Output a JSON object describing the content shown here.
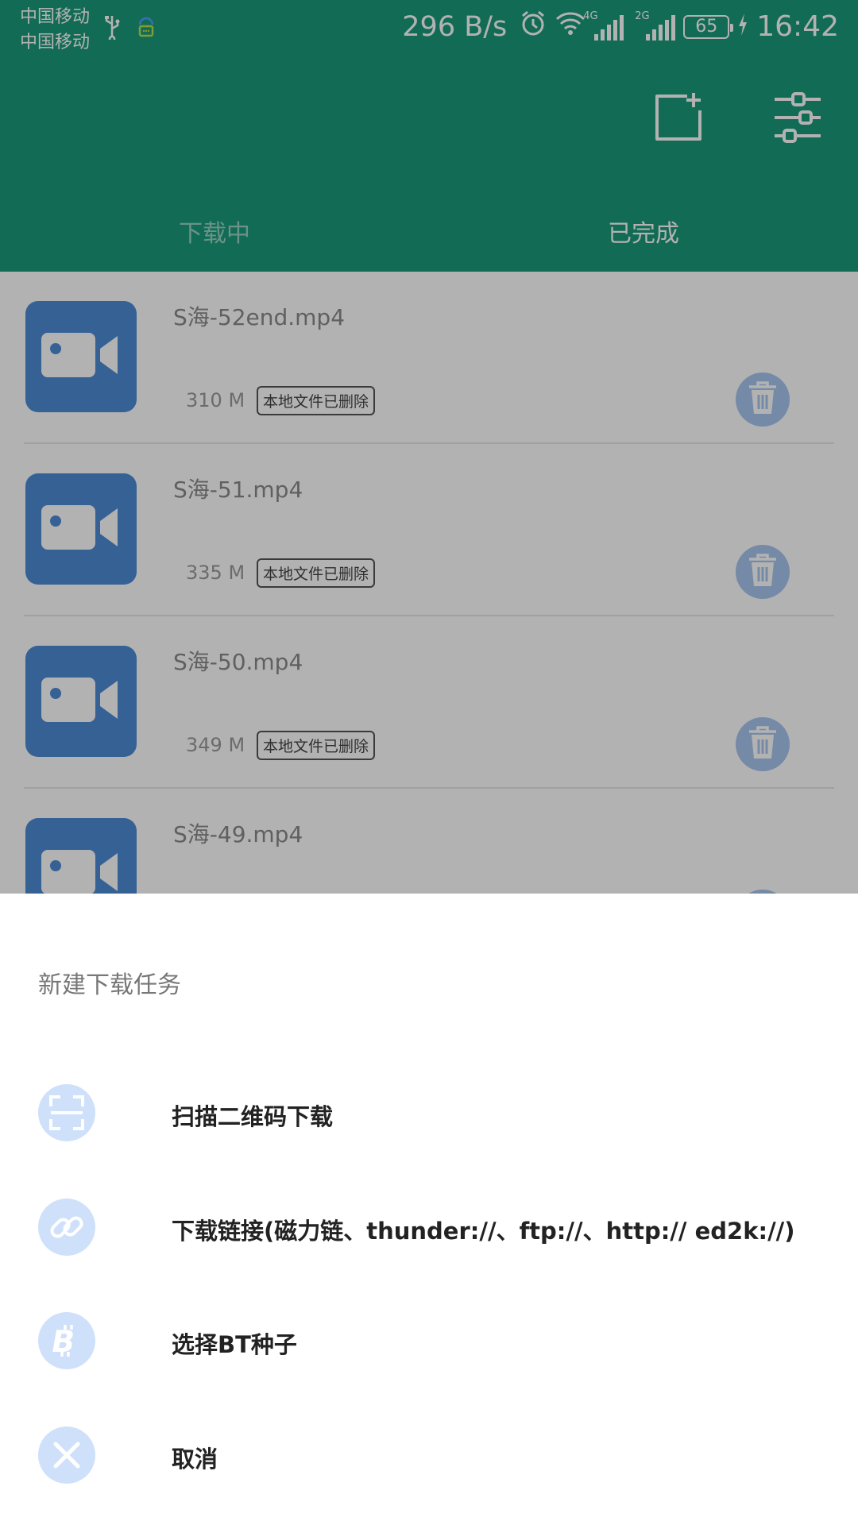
{
  "status_bar": {
    "carrier_1": "中国移动",
    "carrier_2": "中国移动",
    "net_speed": "296 B/s",
    "signal_1_label": "4G",
    "signal_2_label": "2G",
    "battery": "65",
    "time": "16:42"
  },
  "app_bar": {
    "new_task_icon": "new-task-icon",
    "settings_icon": "settings-sliders-icon"
  },
  "tabs": [
    {
      "label": "下载中",
      "active": false
    },
    {
      "label": "已完成",
      "active": true
    }
  ],
  "files": [
    {
      "name": "S海-52end.mp4",
      "size": "310 M",
      "badge": "本地文件已删除"
    },
    {
      "name": "S海-51.mp4",
      "size": "335 M",
      "badge": "本地文件已删除"
    },
    {
      "name": "S海-50.mp4",
      "size": "349 M",
      "badge": "本地文件已删除"
    },
    {
      "name": "S海-49.mp4",
      "size": "",
      "badge": ""
    }
  ],
  "sheet": {
    "title": "新建下载任务",
    "options": [
      {
        "label": "扫描二维码下载",
        "icon": "scan-qr-icon"
      },
      {
        "label": "下载链接(磁力链、thunder://、ftp://、http:// ed2k://)",
        "icon": "link-icon"
      },
      {
        "label": "选择BT种子",
        "icon": "bitcoin-icon"
      },
      {
        "label": "取消",
        "icon": "close-icon"
      }
    ]
  },
  "colors": {
    "primary": "#1a9a7a",
    "thumb": "#4c8bd6",
    "icon_bg": "#cfe0fa"
  }
}
